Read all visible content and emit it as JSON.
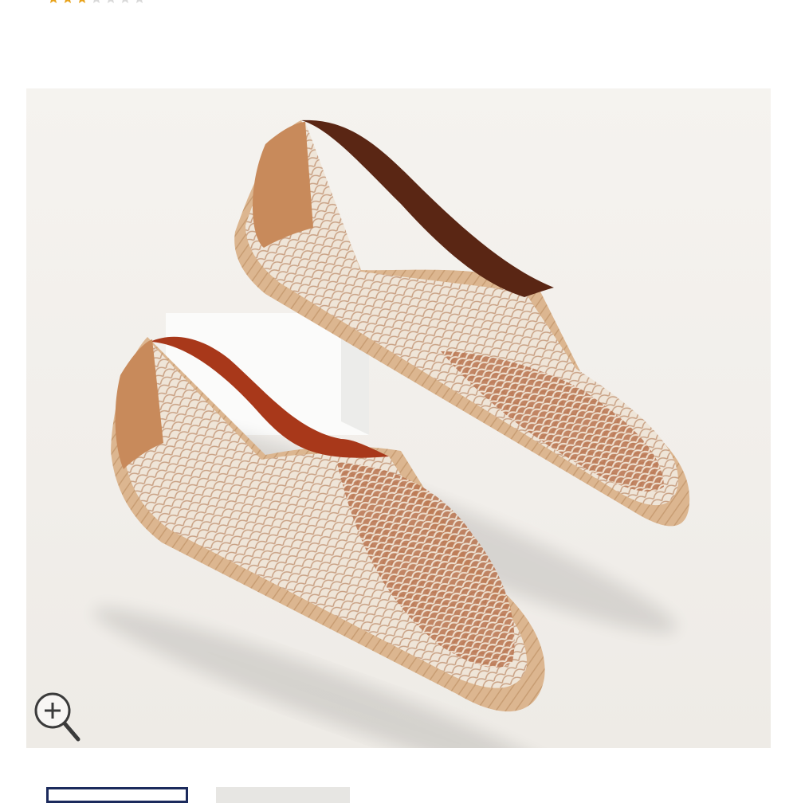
{
  "rating": {
    "stars_filled": 3,
    "stars_total": 7,
    "colors": {
      "filled": "#e8a21a",
      "empty": "#d9d9d9"
    }
  },
  "product_image": {
    "icon": "espadrille-shoes-photo",
    "colors": {
      "background": "#f3f1ed",
      "leather": "#c88a5b",
      "pattern": "#b9744f",
      "jute": "#d8b28c"
    }
  },
  "zoom": {
    "icon": "zoom-in-icon"
  },
  "thumbnails": [
    {
      "icon": "thumbnail-image",
      "selected": true,
      "border_color": "#1b2a5c"
    },
    {
      "icon": "thumbnail-image",
      "selected": false
    }
  ]
}
